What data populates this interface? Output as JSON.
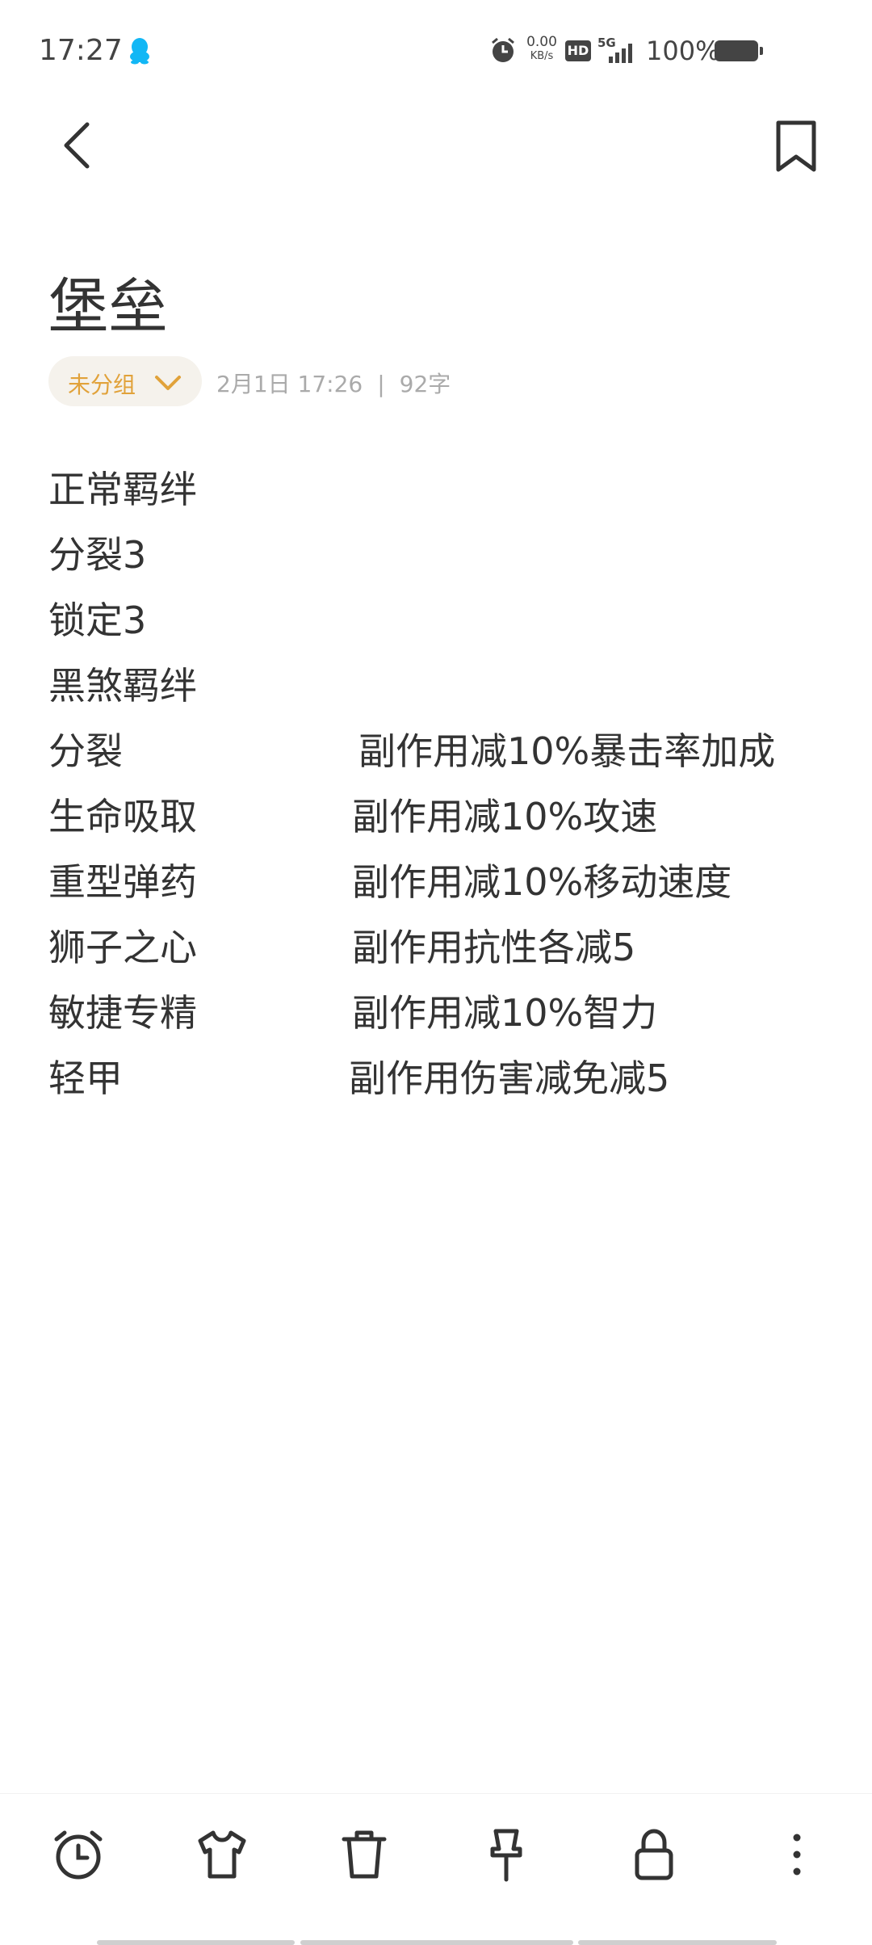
{
  "status_bar": {
    "time": "17:27",
    "net_speed_value": "0.00",
    "net_speed_unit": "KB/s",
    "hd": "HD",
    "network": "5G",
    "battery": "100%"
  },
  "note": {
    "title": "堡垒",
    "group": "未分组",
    "date": "2月1日 17:26",
    "separator": "|",
    "word_count": "92字",
    "lines": [
      {
        "left": "正常羁绊",
        "right": ""
      },
      {
        "left": "分裂3",
        "right": ""
      },
      {
        "left": "锁定3",
        "right": ""
      },
      {
        "left": "黑煞羁绊",
        "right": ""
      },
      {
        "left": "分裂",
        "right": "副作用减10%暴击率加成"
      },
      {
        "left": "生命吸取",
        "right": "副作用减10%攻速"
      },
      {
        "left": "重型弹药",
        "right": "副作用减10%移动速度"
      },
      {
        "left": "狮子之心",
        "right": "副作用抗性各减5"
      },
      {
        "left": "敏捷专精",
        "right": "副作用减10%智力"
      },
      {
        "left": "轻甲",
        "right": "副作用伤害减免减5"
      }
    ]
  },
  "bottom_bar": {
    "icons": [
      "alarm-icon",
      "shirt-icon",
      "trash-icon",
      "pin-icon",
      "lock-icon",
      "more-icon"
    ]
  },
  "colors": {
    "accent": "#e1a23a",
    "chip_bg": "#f5f2ec",
    "text": "#333333",
    "meta_text": "#aaaaaa",
    "qq_blue": "#12b7f5"
  }
}
